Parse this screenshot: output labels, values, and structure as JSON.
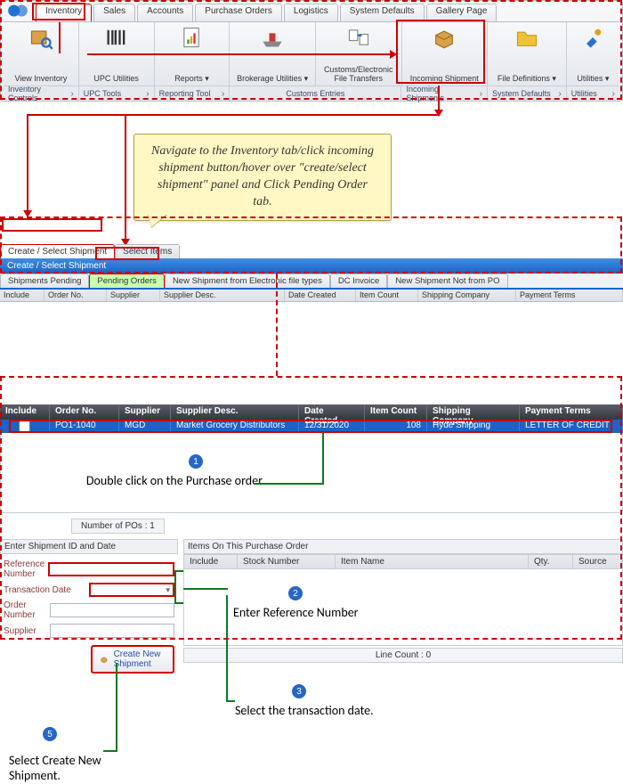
{
  "ribbon": {
    "tabs": [
      "Inventory",
      "Sales",
      "Accounts",
      "Purchase Orders",
      "Logistics",
      "System Defaults",
      "Gallery Page"
    ],
    "groups": [
      {
        "label": "View Inventory",
        "foot": "Inventory Controls"
      },
      {
        "label": "UPC Utilities",
        "foot": "UPC Tools"
      },
      {
        "label": "Reports ▾",
        "foot": "Reporting Tool"
      },
      {
        "label": "Brokerage Utilities ▾",
        "foot": "Customs Entries"
      },
      {
        "label": "Customs/Electronic File Transfers",
        "foot": ""
      },
      {
        "label": "Incoming Shipment",
        "foot": "Incoming Shipments"
      },
      {
        "label": "File Definitions ▾",
        "foot": "System Defaults"
      },
      {
        "label": "Utilities ▾",
        "foot": "Utilities"
      }
    ]
  },
  "callout_text": "Navigate to the Inventory tab/click incoming shipment button/hover over \"create/select shipment\" panel and Click Pending Order tab.",
  "panel": {
    "top_tabs": [
      "Create / Select Shipment",
      "Select Items"
    ],
    "bar_title": "Create / Select Shipment",
    "sub_tabs": [
      "Shipments Pending",
      "Pending Orders",
      "New Shipment from Electronic file types",
      "DC Invoice",
      "New Shipment Not from PO"
    ],
    "headers": [
      "Include",
      "Order No.",
      "Supplier",
      "Supplier Desc.",
      "Date Created",
      "Item Count",
      "Shipping Company",
      "Payment Terms"
    ]
  },
  "table": {
    "headers": [
      "Include",
      "Order No.",
      "Supplier",
      "Supplier Desc.",
      "Date Created",
      "Item Count",
      "Shipping Company",
      "Payment Terms"
    ],
    "row": {
      "order_no": "PO1-1040",
      "supplier": "MGD",
      "supplier_desc": "Market Grocery Distributors",
      "date": "12/31/2020",
      "item_count": "108",
      "ship_co": "Hyde Shipping",
      "pay_terms": "LETTER OF CREDIT"
    },
    "po_count": "Number of POs : 1"
  },
  "form": {
    "section_title": "Enter Shipment ID and Date",
    "ref_label": "Reference Number",
    "date_label": "Transaction Date",
    "order_label": "Order Number",
    "supplier_label": "Supplier",
    "create_btn": "Create New Shipment"
  },
  "items_grid": {
    "title": "Items On This Purchase Order",
    "headers": [
      "Include",
      "Stock Number",
      "Item Name",
      "Qty.",
      "Source"
    ],
    "line_count": "Line Count : 0"
  },
  "steps": {
    "s1": "Double click on the Purchase order.",
    "s2": "Enter Reference Number",
    "s3": "Select the transaction date.",
    "s5": "Select Create New Shipment."
  }
}
